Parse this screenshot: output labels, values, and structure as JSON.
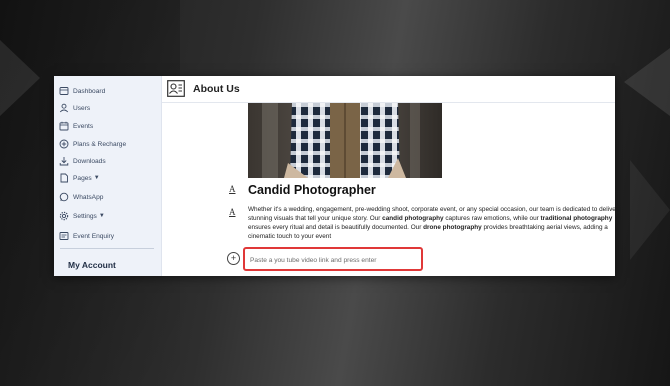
{
  "sidebar": {
    "items": [
      {
        "label": "Dashboard",
        "icon": "dashboard-icon"
      },
      {
        "label": "Users",
        "icon": "users-icon"
      },
      {
        "label": "Events",
        "icon": "calendar-icon"
      },
      {
        "label": "Plans & Recharge",
        "icon": "plus-circle-icon"
      },
      {
        "label": "Downloads",
        "icon": "download-icon"
      },
      {
        "label": "Pages",
        "icon": "pages-icon"
      },
      {
        "label": "WhatsApp",
        "icon": "whatsapp-icon"
      },
      {
        "label": "Settings",
        "icon": "gear-icon"
      },
      {
        "label": "Event Enquiry",
        "icon": "enquiry-icon"
      }
    ],
    "account_heading": "My Account"
  },
  "header": {
    "title": "About Us",
    "icon": "about-card-icon"
  },
  "main": {
    "heading": "Candid Photographer",
    "paragraph": {
      "p1": "Whether it's a wedding, engagement, pre-wedding shoot, corporate event, or any special occasion, our team is dedicated to delivering stunning visuals that tell your unique story. Our ",
      "b1": "candid photography",
      "p2": " captures raw emotions, while our ",
      "b2": "traditional photography",
      "p3": " ensures every ritual and detail is beautifully documented. Our ",
      "b3": "drone photography",
      "p4": " provides breathtaking aerial views, adding a cinematic touch to your event"
    },
    "text_tool_glyph": "A",
    "add_glyph": "+",
    "video_input": {
      "placeholder": "Paste a you tube video link and press enter",
      "value": ""
    }
  },
  "colors": {
    "sidebar_bg": "#eef2f9",
    "highlight_border": "#e03838"
  }
}
